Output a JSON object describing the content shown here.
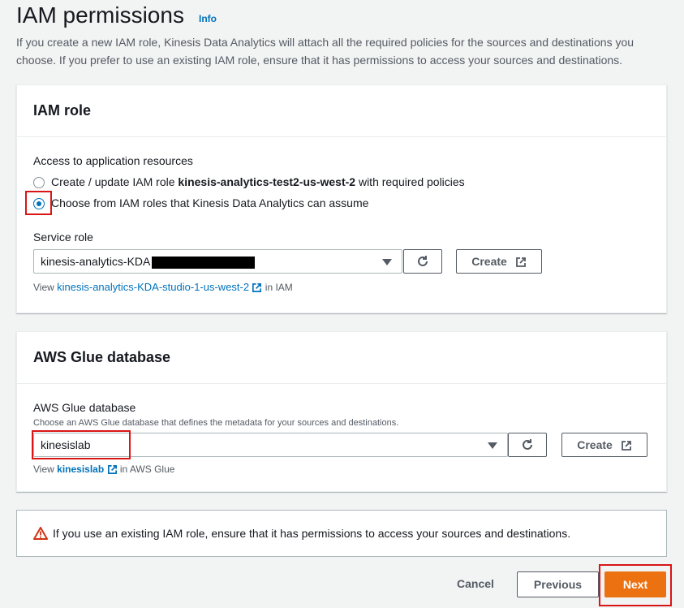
{
  "header": {
    "title": "IAM permissions",
    "info_link": "Info",
    "description": "If you create a new IAM role, Kinesis Data Analytics will attach all the required policies for the sources and destinations you choose. If you prefer to use an existing IAM role, ensure that it has permissions to access your sources and destinations."
  },
  "iam_role": {
    "title": "IAM role",
    "access_label": "Access to application resources",
    "option_create_prefix": "Create / update IAM role ",
    "option_create_role": "kinesis-analytics-test2-us-west-2",
    "option_create_suffix": " with required policies",
    "option_choose": "Choose from IAM roles that Kinesis Data Analytics can assume",
    "service_role_label": "Service role",
    "service_role_value": "kinesis-analytics-KDA",
    "create_button": "Create",
    "view_prefix": "View ",
    "view_link": "kinesis-analytics-KDA-studio-1-us-west-2",
    "view_suffix": " in IAM"
  },
  "glue": {
    "title": "AWS Glue database",
    "field_label": "AWS Glue database",
    "field_description": "Choose an AWS Glue database that defines the metadata for your sources and destinations.",
    "value": "kinesislab",
    "create_button": "Create",
    "view_prefix": "View ",
    "view_link": "kinesislab",
    "view_suffix": " in AWS Glue"
  },
  "warning": {
    "text": "If you use an existing IAM role, ensure that it has permissions to access your sources and destinations."
  },
  "footer": {
    "cancel": "Cancel",
    "previous": "Previous",
    "next": "Next"
  },
  "colors": {
    "accent": "#0073bb",
    "primary_button": "#ec7211",
    "highlight": "#d91515",
    "warning": "#d13212"
  }
}
